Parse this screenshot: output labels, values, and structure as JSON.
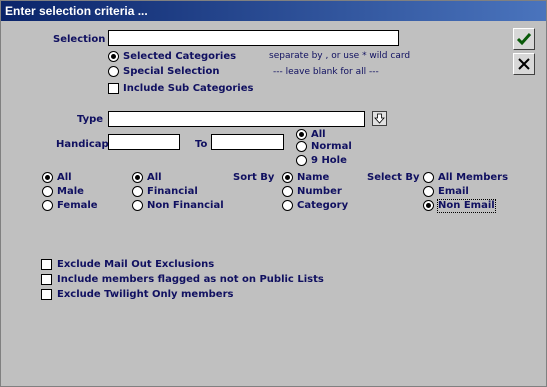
{
  "window": {
    "title": "Enter selection criteria ..."
  },
  "selection": {
    "label": "Selection",
    "value": "",
    "options": [
      "Selected Categories",
      "Special Selection"
    ],
    "selected": "Selected Categories",
    "include_sub_categories_label": "Include Sub Categories",
    "include_sub_categories": false,
    "hint1": "separate by  , or use * wild card",
    "hint2": "---   leave blank for all   ---"
  },
  "type": {
    "label": "Type",
    "value": ""
  },
  "handicap": {
    "label": "Handicap",
    "from": "",
    "to_label": "To",
    "to": "",
    "options": [
      "All",
      "Normal",
      "9 Hole"
    ],
    "selected": "All"
  },
  "gender": {
    "options": [
      "All",
      "Male",
      "Female"
    ],
    "selected": "All"
  },
  "financial": {
    "options": [
      "All",
      "Financial",
      "Non Financial"
    ],
    "selected": "All"
  },
  "sort_by": {
    "label": "Sort By",
    "options": [
      "Name",
      "Number",
      "Category"
    ],
    "selected": "Name"
  },
  "select_by": {
    "label": "Select By",
    "options": [
      "All Members",
      "Email",
      "Non Email"
    ],
    "selected": "Non Email"
  },
  "exclusions": [
    {
      "label": "Exclude Mail Out Exclusions",
      "checked": false
    },
    {
      "label": "Include members flagged as not on Public Lists",
      "checked": false
    },
    {
      "label": "Exclude Twilight Only members",
      "checked": false
    }
  ],
  "buttons": {
    "ok_icon": "checkmark-icon",
    "cancel_icon": "x-icon"
  },
  "colors": {
    "title_bar": "#0a246a",
    "label_text": "#101060",
    "background": "#c0c0c0"
  }
}
